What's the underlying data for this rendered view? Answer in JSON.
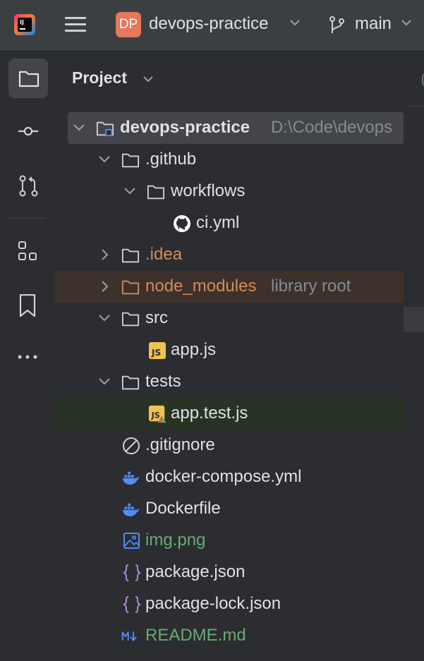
{
  "titlebar": {
    "app_logo_text": "IJ",
    "menu_icon": "hamburger-menu-icon",
    "project_badge": "DP",
    "project_name": "devops-practice",
    "branch_name": "main"
  },
  "tool_stripe": {
    "items": [
      {
        "icon": "folder-icon",
        "active": true
      },
      {
        "icon": "commit-icon"
      },
      {
        "icon": "pull-requests-icon"
      },
      {
        "icon": "structure-icon"
      },
      {
        "icon": "bookmark-icon"
      },
      {
        "icon": "more-icon"
      }
    ]
  },
  "panel": {
    "title": "Project",
    "root": {
      "name": "devops-practice",
      "path": "D:\\Code\\devops"
    },
    "tree": {
      "github": ".github",
      "workflows": "workflows",
      "ci": "ci.yml",
      "idea": ".idea",
      "node_modules": "node_modules",
      "node_modules_hint": "library root",
      "src": "src",
      "app_js": "app.js",
      "tests": "tests",
      "app_test_js": "app.test.js",
      "gitignore": ".gitignore",
      "docker_compose": "docker-compose.yml",
      "dockerfile": "Dockerfile",
      "img": "img.png",
      "package_json": "package.json",
      "package_lock": "package-lock.json",
      "readme": "README.md"
    }
  },
  "colors": {
    "background": "#2b2d30",
    "titlebar": "#3c3f41",
    "selected_row": "#43454a",
    "library_row": "#3d322b",
    "test_row": "#283325",
    "excluded_text": "#d4895b",
    "new_file_text": "#6aab73"
  }
}
